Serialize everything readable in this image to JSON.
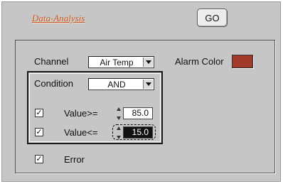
{
  "header": {
    "title_link": "Data-Analysis",
    "go_label": "GO"
  },
  "channel": {
    "label": "Channel",
    "selected": "Air Temp"
  },
  "alarm": {
    "label": "Alarm Color",
    "color": "#a23a2a"
  },
  "condition": {
    "label": "Condition",
    "selected": "AND",
    "rows": [
      {
        "label": "Value>=",
        "checked": true,
        "check_mark": "✓",
        "value": "85.0"
      },
      {
        "label": "Value<=",
        "checked": true,
        "check_mark": "✓",
        "value": "15.0"
      }
    ]
  },
  "error": {
    "label": "Error",
    "checked": true,
    "check_mark": "✓"
  }
}
